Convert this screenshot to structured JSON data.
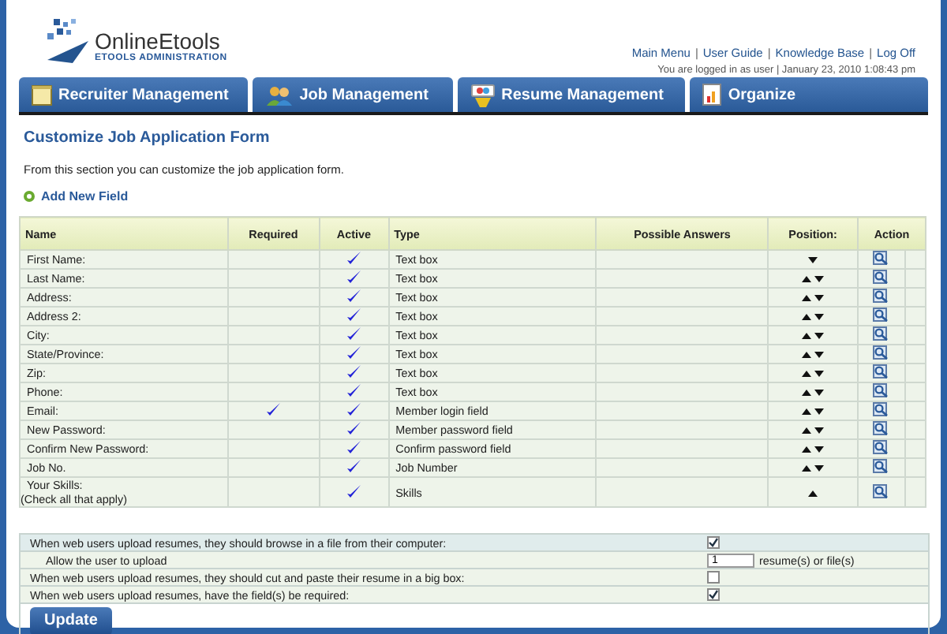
{
  "logo": {
    "name": "OnlineEtools",
    "subtitle": "ETOOLS ADMINISTRATION"
  },
  "top_links": [
    {
      "kind": "link",
      "text": "Main Menu"
    },
    {
      "kind": "separator",
      "text": "|"
    },
    {
      "kind": "link",
      "text": "User Guide"
    },
    {
      "kind": "separator",
      "text": "|"
    },
    {
      "kind": "link",
      "text": "Knowledge Base"
    },
    {
      "kind": "separator",
      "text": "|"
    },
    {
      "kind": "link",
      "text": "Log Off"
    }
  ],
  "login_info": "You are logged in as user | January 23, 2010 1:08:43 pm",
  "tabs": [
    {
      "label": "Recruiter Management",
      "selected": false
    },
    {
      "label": "Job Management",
      "selected": false
    },
    {
      "label": "Resume Management",
      "selected": false
    },
    {
      "label": "Organize",
      "selected": false
    }
  ],
  "page_title": "Customize Job Application Form",
  "intro": "From this section you can customize the job application form.",
  "add_link": "Add New Field",
  "table": {
    "columns": [
      "Name",
      "Required",
      "Active",
      "Type",
      "Possible Answers",
      "Position:",
      "Action"
    ],
    "rows": [
      {
        "name": "First Name:",
        "required": false,
        "active": true,
        "type": "Text box",
        "up": false,
        "down": true
      },
      {
        "name": "Last Name:",
        "required": false,
        "active": true,
        "type": "Text box",
        "up": true,
        "down": true
      },
      {
        "name": "Address:",
        "required": false,
        "active": true,
        "type": "Text box",
        "up": true,
        "down": true
      },
      {
        "name": "Address 2:",
        "required": false,
        "active": true,
        "type": "Text box",
        "up": true,
        "down": true
      },
      {
        "name": "City:",
        "required": false,
        "active": true,
        "type": "Text box",
        "up": true,
        "down": true
      },
      {
        "name": "State/Province:",
        "required": false,
        "active": true,
        "type": "Text box",
        "up": true,
        "down": true
      },
      {
        "name": "Zip:",
        "required": false,
        "active": true,
        "type": "Text box",
        "up": true,
        "down": true
      },
      {
        "name": "Phone:",
        "required": false,
        "active": true,
        "type": "Text box",
        "up": true,
        "down": true
      },
      {
        "name": "Email:",
        "required": true,
        "active": true,
        "type": "Member login field",
        "up": true,
        "down": true
      },
      {
        "name": "New Password:",
        "required": false,
        "active": true,
        "type": "Member password field",
        "up": true,
        "down": true
      },
      {
        "name": "Confirm New Password:",
        "required": false,
        "active": true,
        "type": "Confirm password field",
        "up": true,
        "down": true
      },
      {
        "name": "Job No.",
        "required": false,
        "active": true,
        "type": "Job Number",
        "up": true,
        "down": true
      },
      {
        "name": "Your Skills:",
        "note": "(Check all that apply)",
        "required": false,
        "active": true,
        "type": "Skills",
        "up": true,
        "down": false
      }
    ]
  },
  "options": [
    {
      "kind": "checkbox",
      "label": "When web users upload resumes, they should browse in a file from their computer:",
      "checked": true
    },
    {
      "kind": "number",
      "label": "Allow the user to upload",
      "value": "1",
      "suffix": "resume(s) or file(s)"
    },
    {
      "kind": "checkbox",
      "label": "When web users upload resumes, they should cut and paste their resume in a big box:",
      "checked": false
    },
    {
      "kind": "checkbox",
      "label": "When web users upload resumes, have the field(s) be required:",
      "checked": true
    }
  ],
  "update_button": "Update"
}
